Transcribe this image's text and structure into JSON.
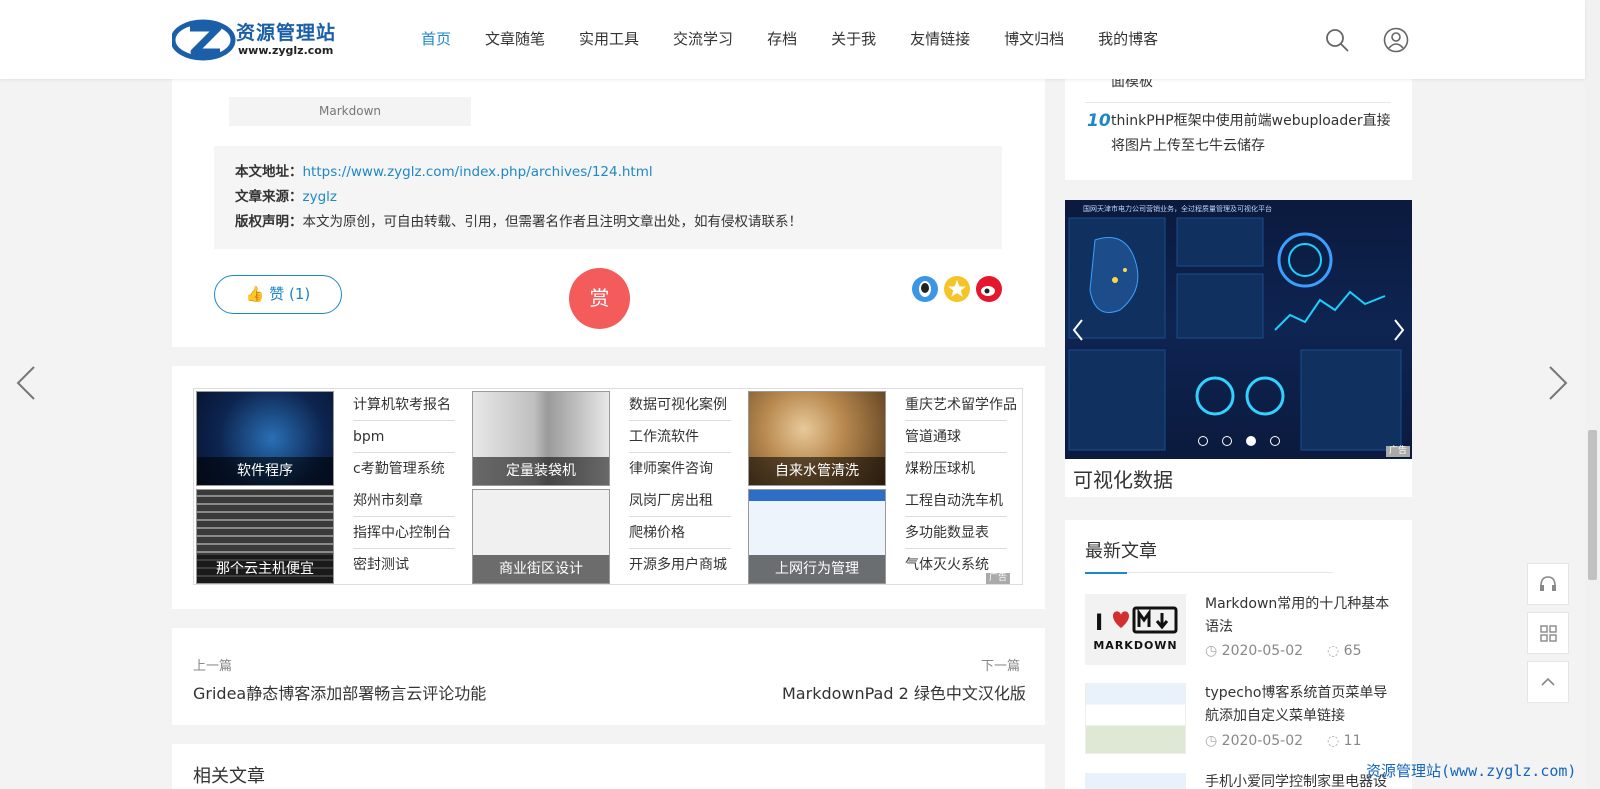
{
  "header": {
    "logo_text": "资源管理站",
    "logo_url": "www.zyglz.com",
    "nav": [
      "首页",
      "文章随笔",
      "实用工具",
      "交流学习",
      "存档",
      "关于我",
      "友情链接",
      "博文归档",
      "我的博客"
    ],
    "active_index": 0
  },
  "article": {
    "tag": "Markdown",
    "url_label": "本文地址：",
    "url": "https://www.zyglz.com/index.php/archives/124.html",
    "source_label": "文章来源：",
    "source": "zyglz",
    "copyright_label": "版权声明：",
    "copyright": "本文为原创，可自由转载、引用，但需署名作者且注明文章出处，如有侵权请联系！",
    "like": "赞 (1)",
    "reward": "赏"
  },
  "ads": {
    "images": [
      {
        "caption": "软件程序"
      },
      {
        "caption": "定量装袋机"
      },
      {
        "caption": "自来水管清洗"
      },
      {
        "caption": "那个云主机便宜"
      },
      {
        "caption": "商业街区设计"
      },
      {
        "caption": "上网行为管理"
      }
    ],
    "links_col1": [
      "计算机软考报名",
      "bpm",
      "c考勤管理系统",
      "郑州市刻章",
      "指挥中心控制台",
      "密封测试"
    ],
    "links_col2": [
      "数据可视化案例",
      "工作流软件",
      "律师案件咨询",
      "凤岗厂房出租",
      "爬梯价格",
      "开源多用户商城"
    ],
    "links_col3": [
      "重庆艺术留学作品",
      "管道通球",
      "煤粉压球机",
      "工程自动洗车机",
      "多功能数显表",
      "气体灭火系统"
    ],
    "badge": "广告"
  },
  "pager": {
    "prev_label": "上一篇",
    "prev_title": "Gridea静态博客添加部署畅言云评论功能",
    "next_label": "下一篇",
    "next_title": "MarkdownPad 2 绿色中文汉化版"
  },
  "related": {
    "title": "相关文章"
  },
  "sidebar": {
    "rank_partial": "面模板",
    "rank_num": "10",
    "rank_title": "thinkPHP框架中使用前端webuploader直接将图片上传至七牛云储存",
    "slider_caption": "可视化数据",
    "slider_badge": "广告",
    "slider_header": "国网天津市电力公司营销业务，全过程质量管理及可视化平台",
    "latest_title": "最新文章",
    "articles": [
      {
        "title": "Markdown常用的十几种基本语法",
        "date": "2020-05-02",
        "comments": "65",
        "thumb_text": "MARKDOWN"
      },
      {
        "title": "typecho博客系统首页菜单导航添加自定义菜单链接",
        "date": "2020-05-02",
        "comments": "11"
      },
      {
        "title": "手机小爱同学控制家里电器设"
      }
    ]
  },
  "watermark": "资源管理站(www.zyglz.com)",
  "colors": {
    "accent": "#1e88c7",
    "reward": "#f45b5b"
  }
}
